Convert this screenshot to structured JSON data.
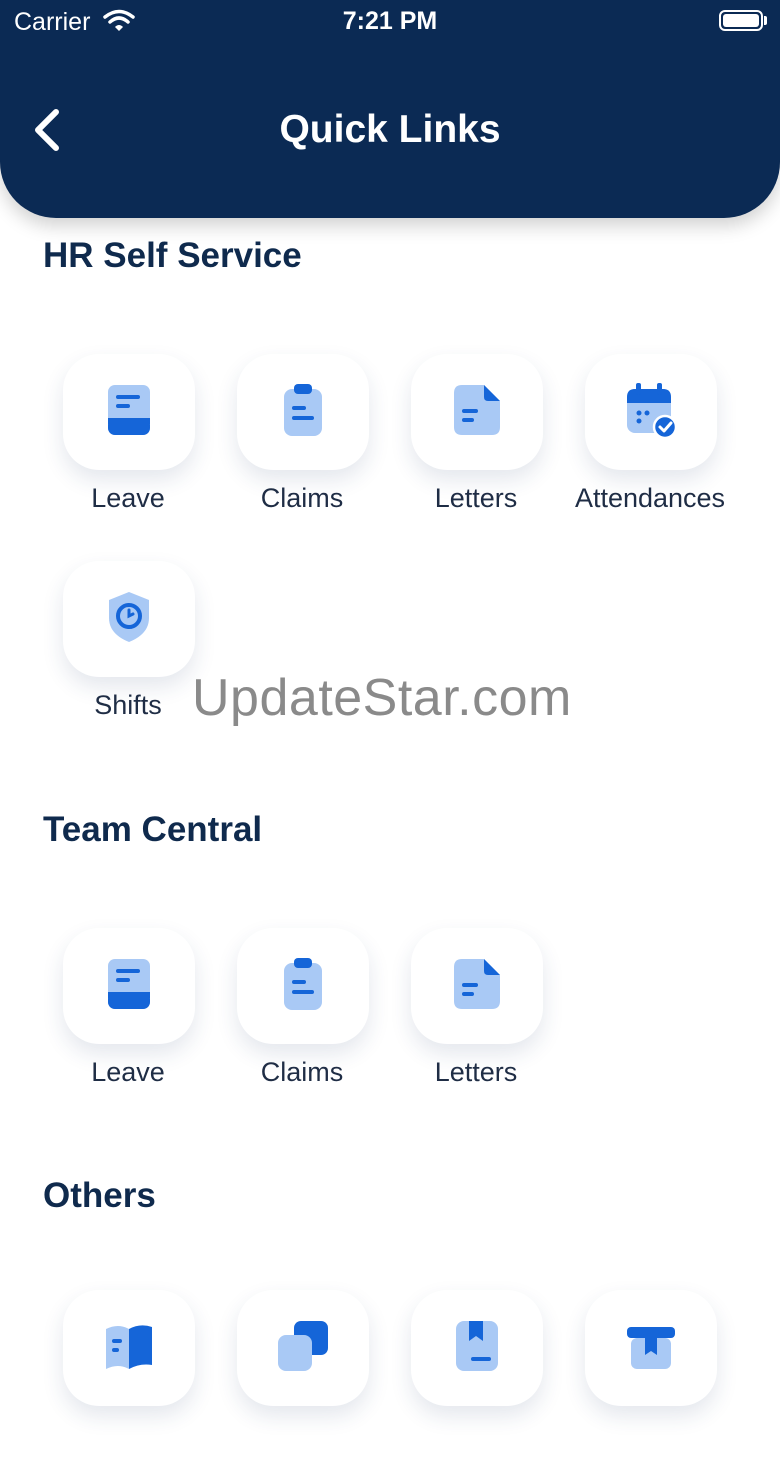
{
  "status": {
    "carrier": "Carrier",
    "time": "7:21 PM"
  },
  "header": {
    "title": "Quick Links"
  },
  "sections": [
    {
      "title": "HR Self Service",
      "items": [
        {
          "label": "Leave",
          "icon": "leave-icon"
        },
        {
          "label": "Claims",
          "icon": "claims-icon"
        },
        {
          "label": "Letters",
          "icon": "letters-icon"
        },
        {
          "label": "Attendances",
          "icon": "attendance-calendar-icon"
        },
        {
          "label": "Shifts",
          "icon": "shift-shield-icon"
        }
      ]
    },
    {
      "title": "Team Central",
      "items": [
        {
          "label": "Leave",
          "icon": "leave-icon"
        },
        {
          "label": "Claims",
          "icon": "claims-icon"
        },
        {
          "label": "Letters",
          "icon": "letters-icon"
        }
      ]
    },
    {
      "title": "Others",
      "items": [
        {
          "icon": "book-icon"
        },
        {
          "icon": "copy-icon"
        },
        {
          "icon": "bookmark-icon"
        },
        {
          "icon": "gift-icon"
        }
      ]
    }
  ],
  "watermark": "UpdateStar.com",
  "colors": {
    "header_bg": "#0b2a54",
    "icon_dark": "#1565d8",
    "icon_light": "#a9c9f5"
  }
}
